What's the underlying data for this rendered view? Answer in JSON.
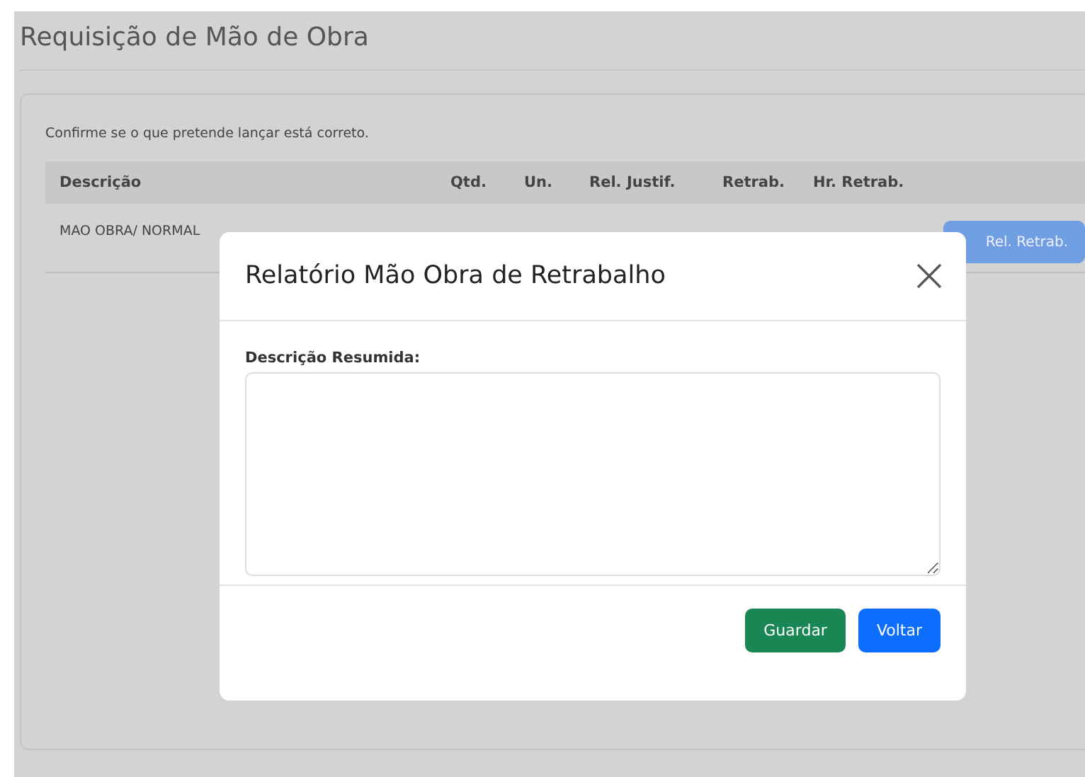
{
  "page": {
    "title": "Requisição de Mão de Obra",
    "instruction": "Confirme se o que pretende lançar está correto."
  },
  "table": {
    "columns": [
      "Descrição",
      "Qtd.",
      "Un.",
      "Rel. Justif.",
      "Retrab.",
      "Hr. Retrab."
    ],
    "rows": [
      {
        "descricao": "MAO OBRA/ NORMAL",
        "action": "Rel. Retrab."
      }
    ]
  },
  "modal": {
    "title": "Relatório Mão Obra de Retrabalho",
    "field_label": "Descrição Resumida:",
    "buttons": [
      {
        "label": "Guardar",
        "kind": "primary-success"
      },
      {
        "label": "Voltar",
        "kind": "primary"
      }
    ]
  }
}
